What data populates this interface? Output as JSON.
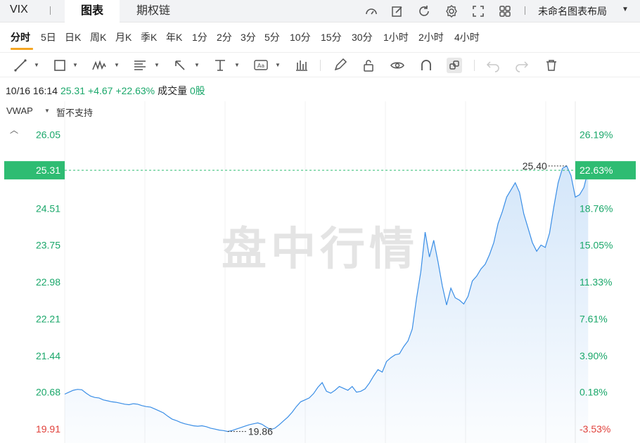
{
  "header": {
    "ticker": "VIX",
    "tabs": [
      {
        "label": "图表",
        "active": true
      },
      {
        "label": "期权链",
        "active": false
      }
    ],
    "layout_label": "未命名图表布局",
    "icons": [
      "gauge-icon",
      "edit-icon",
      "refresh-icon",
      "settings-icon",
      "fullscreen-icon",
      "grid-layout-icon"
    ]
  },
  "periods": [
    "分时",
    "5日",
    "日K",
    "周K",
    "月K",
    "季K",
    "年K",
    "1分",
    "2分",
    "3分",
    "5分",
    "10分",
    "15分",
    "30分",
    "1小时",
    "2小时",
    "4小时"
  ],
  "active_period": "分时",
  "toolbar": {
    "tools": [
      "line-tool-icon",
      "rectangle-tool-icon",
      "pattern-tool-icon",
      "fibonacci-tool-icon",
      "arrow-tool-icon",
      "measure-tool-icon",
      "text-tool-icon",
      "indicator-icon",
      "pencil-icon",
      "lock-icon",
      "eye-icon",
      "magnet-icon",
      "link-icon",
      "undo-icon",
      "redo-icon",
      "trash-icon"
    ]
  },
  "quote": {
    "datetime": "10/16 16:14",
    "price": "25.31",
    "change": "+4.67",
    "change_pct": "+22.63%",
    "volume_label": "成交量",
    "volume_value": "0股"
  },
  "indicator": {
    "name": "VWAP",
    "status": "暂不支持"
  },
  "watermark": "盘中行情",
  "colors": {
    "line": "#3a8ee6",
    "up": "#1aa76a",
    "down": "#e0413b",
    "current_tag": "#2ebc72",
    "period_underline": "#f5a623"
  },
  "chart_data": {
    "type": "area",
    "y_ticks_left": [
      "26.05",
      "25.31",
      "24.51",
      "23.75",
      "22.98",
      "22.21",
      "21.44",
      "20.68",
      "19.91"
    ],
    "y_ticks_right": [
      "26.19%",
      "22.63%",
      "18.76%",
      "15.05%",
      "11.33%",
      "7.61%",
      "3.90%",
      "0.18%",
      "-3.53%"
    ],
    "reference_price": 20.64,
    "current_price": 25.31,
    "current_pct": "22.63%",
    "high_label": "25.40",
    "low_label": "19.86",
    "ylim": [
      19.62,
      26.75
    ],
    "x_points": 120,
    "series": [
      {
        "values": [
          20.64,
          20.68,
          20.72,
          20.74,
          20.73,
          20.66,
          20.6,
          20.57,
          20.56,
          20.52,
          20.5,
          20.48,
          20.47,
          20.45,
          20.43,
          20.42,
          20.44,
          20.43,
          20.4,
          20.38,
          20.37,
          20.33,
          20.29,
          20.25,
          20.18,
          20.12,
          20.09,
          20.05,
          20.02,
          20.0,
          19.98,
          19.97,
          19.98,
          19.96,
          19.93,
          19.91,
          19.89,
          19.88,
          19.86,
          19.88,
          19.91,
          19.94,
          19.97,
          20.0,
          20.02,
          20.04,
          20.01,
          19.95,
          19.9,
          19.93,
          20.0,
          20.08,
          20.16,
          20.26,
          20.38,
          20.48,
          20.52,
          20.56,
          20.65,
          20.78,
          20.88,
          20.7,
          20.66,
          20.72,
          20.8,
          20.76,
          20.72,
          20.8,
          20.68,
          20.7,
          20.75,
          20.87,
          21.02,
          21.15,
          21.1,
          21.32,
          21.4,
          21.46,
          21.48,
          21.63,
          21.75,
          22.0,
          22.64,
          23.2,
          24.02,
          23.5,
          23.85,
          23.4,
          22.9,
          22.5,
          22.85,
          22.65,
          22.6,
          22.52,
          22.68,
          23.0,
          23.1,
          23.25,
          23.35,
          23.55,
          23.8,
          24.2,
          24.45,
          24.75,
          24.9,
          25.05,
          24.85,
          24.4,
          24.1,
          23.8,
          23.62,
          23.75,
          23.7,
          24.0,
          24.55,
          25.05,
          25.35,
          25.4,
          25.2,
          24.75,
          24.8,
          24.95,
          25.31
        ]
      }
    ]
  }
}
